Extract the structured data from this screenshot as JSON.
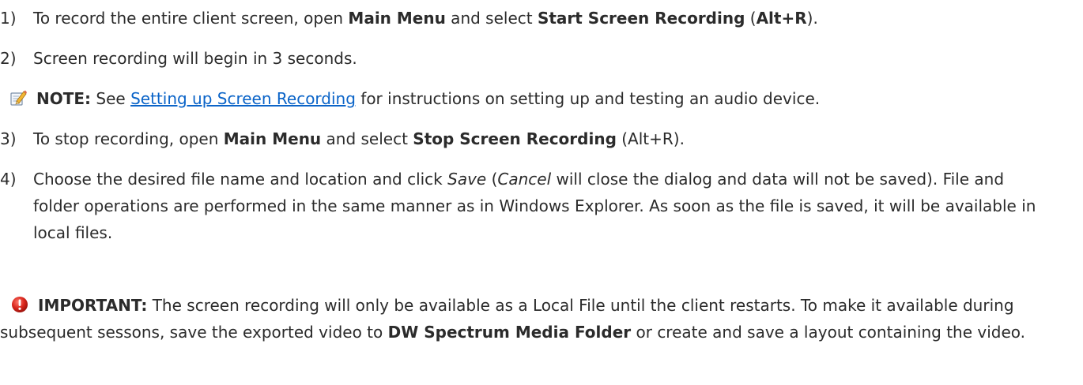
{
  "steps": [
    {
      "num": "1)",
      "t1": "To record the entire client screen, open ",
      "b1": "Main Menu",
      "t2": " and select ",
      "b2": "Start Screen Recording",
      "t3": " (",
      "b3": "Alt+R",
      "t4": ")."
    },
    {
      "num": "2)",
      "t1": "Screen recording will begin in 3 seconds."
    },
    {
      "num": "3)",
      "t1": "To stop recording, open ",
      "b1": "Main Menu",
      "t2": " and select ",
      "b2": "Stop Screen Recording",
      "t3": " (Alt+R)."
    },
    {
      "num": "4)",
      "t1": "Choose the desired file name and location and click ",
      "i1": "Save",
      "t2": " (",
      "i2": "Cancel",
      "t3": " will close the dialog and data will not be saved). File and folder operations are performed in the same manner as in Windows Explorer. As soon as the file is saved, it will be available in local files."
    }
  ],
  "note": {
    "icon": "note-pencil-icon",
    "label": "NOTE:",
    "t1": " See ",
    "link": "Setting up Screen Recording",
    "t2": " for instructions on setting up and testing an audio device."
  },
  "important": {
    "icon": "important-alert-icon",
    "label": "IMPORTANT:",
    "t1": " The screen recording will only be available as a Local File until the client restarts. To make it available during subsequent sessons, save the exported video to ",
    "b1": "DW Spectrum Media Folder",
    "t2": " or create and save a layout containing the video."
  },
  "colors": {
    "text": "#2b2b2b",
    "link": "#0b64c8",
    "important_icon": "#d9261c"
  }
}
